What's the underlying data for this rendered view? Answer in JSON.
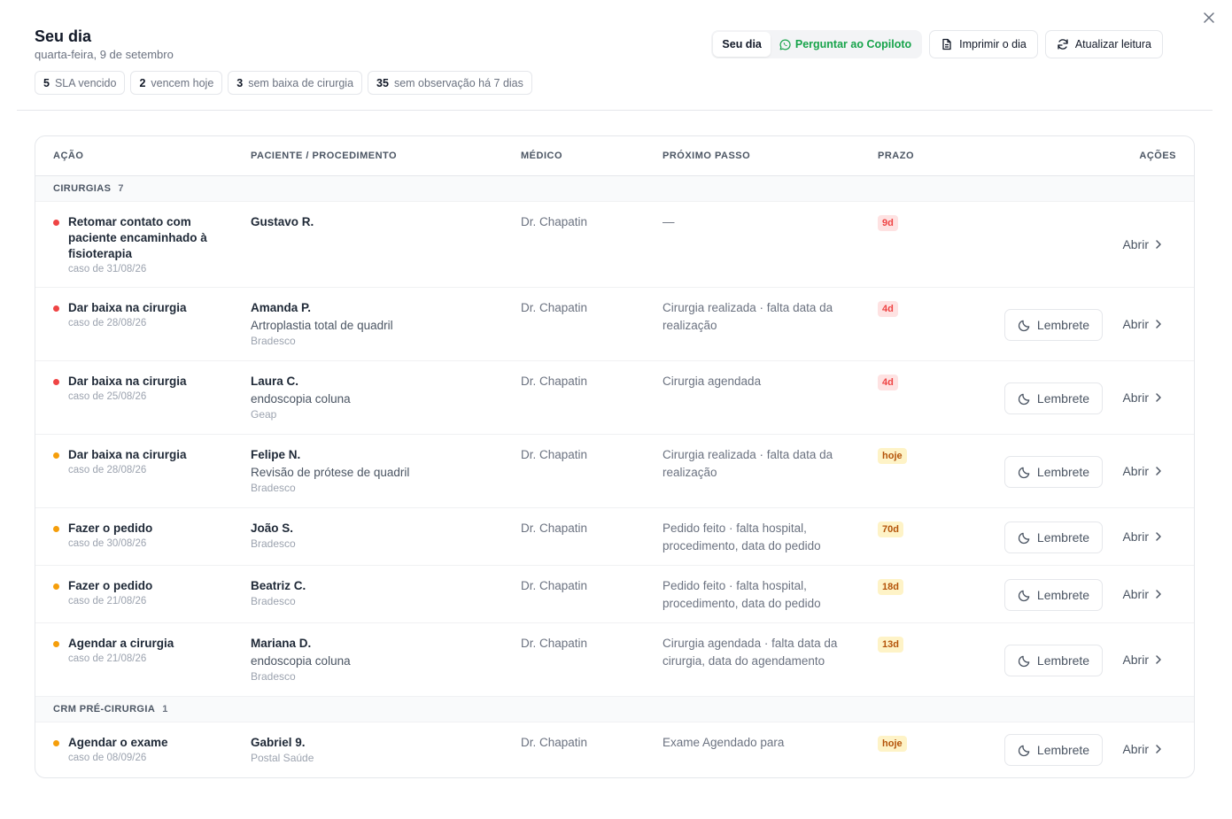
{
  "header": {
    "title": "Seu dia",
    "subtitle": "quarta-feira, 9 de setembro"
  },
  "chips": [
    {
      "count": "5",
      "label": "SLA vencido"
    },
    {
      "count": "2",
      "label": "vencem hoje"
    },
    {
      "count": "3",
      "label": "sem baixa de cirurgia"
    },
    {
      "count": "35",
      "label": "sem observação há 7 dias"
    }
  ],
  "toolbar": {
    "seu_dia": "Seu dia",
    "copilot": "Perguntar ao Copiloto",
    "print": "Imprimir o dia",
    "refresh": "Atualizar leitura"
  },
  "table": {
    "columns": {
      "acao": "AÇÃO",
      "paciente": "PACIENTE / PROCEDIMENTO",
      "medico": "MÉDICO",
      "proximo": "PRÓXIMO PASSO",
      "prazo": "PRAZO",
      "acoes": "AÇÕES"
    },
    "lembrete_label": "Lembrete",
    "abrir_label": "Abrir",
    "groups": [
      {
        "name": "CIRURGIAS",
        "count": "7",
        "rows": [
          {
            "acao": "Retomar contato com paciente encaminhado à fisioterapia",
            "caso": "caso de 31/08/26",
            "dot": "red",
            "paciente": "Gustavo R.",
            "procedimento": "",
            "convenio": "",
            "medico": "Dr. Chapatin",
            "proximo": "—",
            "prazo": "9d",
            "prazo_tone": "red",
            "lembrete": false
          },
          {
            "acao": "Dar baixa na cirurgia",
            "caso": "caso de 28/08/26",
            "dot": "red",
            "paciente": "Amanda P.",
            "procedimento": "Artroplastia total de quadril",
            "convenio": "Bradesco",
            "medico": "Dr. Chapatin",
            "proximo": "Cirurgia realizada · falta data da realização",
            "prazo": "4d",
            "prazo_tone": "red",
            "lembrete": true
          },
          {
            "acao": "Dar baixa na cirurgia",
            "caso": "caso de 25/08/26",
            "dot": "red",
            "paciente": "Laura C.",
            "procedimento": "endoscopia coluna",
            "convenio": "Geap",
            "medico": "Dr. Chapatin",
            "proximo": "Cirurgia agendada",
            "prazo": "4d",
            "prazo_tone": "red",
            "lembrete": true
          },
          {
            "acao": "Dar baixa na cirurgia",
            "caso": "caso de 28/08/26",
            "dot": "orange",
            "paciente": "Felipe N.",
            "procedimento": "Revisão de prótese de quadril",
            "convenio": "Bradesco",
            "medico": "Dr. Chapatin",
            "proximo": "Cirurgia realizada · falta data da realização",
            "prazo": "hoje",
            "prazo_tone": "orange",
            "lembrete": true
          },
          {
            "acao": "Fazer o pedido",
            "caso": "caso de 30/08/26",
            "dot": "orange",
            "paciente": "João S.",
            "procedimento": "",
            "convenio": "Bradesco",
            "medico": "Dr. Chapatin",
            "proximo": "Pedido feito · falta hospital, procedimento, data do pedido",
            "prazo": "70d",
            "prazo_tone": "orange",
            "lembrete": true
          },
          {
            "acao": "Fazer o pedido",
            "caso": "caso de 21/08/26",
            "dot": "orange",
            "paciente": "Beatriz C.",
            "procedimento": "",
            "convenio": "Bradesco",
            "medico": "Dr. Chapatin",
            "proximo": "Pedido feito · falta hospital, procedimento, data do pedido",
            "prazo": "18d",
            "prazo_tone": "orange",
            "lembrete": true
          },
          {
            "acao": "Agendar a cirurgia",
            "caso": "caso de 21/08/26",
            "dot": "orange",
            "paciente": "Mariana D.",
            "procedimento": "endoscopia coluna",
            "convenio": "Bradesco",
            "medico": "Dr. Chapatin",
            "proximo": "Cirurgia agendada · falta data da cirurgia, data do agendamento",
            "prazo": "13d",
            "prazo_tone": "orange",
            "lembrete": true
          }
        ]
      },
      {
        "name": "CRM PRÉ-CIRURGIA",
        "count": "1",
        "rows": [
          {
            "acao": "Agendar o exame",
            "caso": "caso de 08/09/26",
            "dot": "orange",
            "paciente": "Gabriel 9.",
            "procedimento": "",
            "convenio": "Postal Saúde",
            "medico": "Dr. Chapatin",
            "proximo": "Exame Agendado para",
            "prazo": "hoje",
            "prazo_tone": "orange",
            "lembrete": true
          }
        ]
      }
    ]
  },
  "colors": {
    "red": "#ef4444",
    "orange": "#f59e0b",
    "green": "#16a34a"
  },
  "icons": [
    "close-icon",
    "whatsapp-icon",
    "document-icon",
    "refresh-icon",
    "moon-icon",
    "chevron-right-icon"
  ]
}
